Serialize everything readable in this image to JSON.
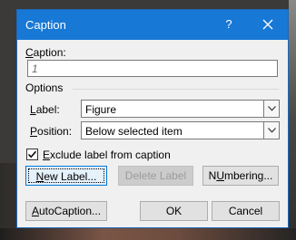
{
  "window": {
    "title": "Caption",
    "help_glyph": "?",
    "close_icon": "close-icon"
  },
  "caption": {
    "label": "Caption:",
    "label_underline": "C",
    "label_rest": "aption:",
    "value": "1"
  },
  "options": {
    "group_label": "Options",
    "label_field": {
      "underline": "L",
      "rest": "abel:",
      "value": "Figure"
    },
    "position_field": {
      "underline": "P",
      "rest": "osition:",
      "value": "Below selected item"
    }
  },
  "exclude": {
    "checked": true,
    "underline": "E",
    "rest": "xclude label from caption"
  },
  "buttons": {
    "new_label": {
      "underline": "N",
      "rest": "ew Label..."
    },
    "delete_label": "Delete Label",
    "numbering": {
      "underline": "U",
      "pre": "N",
      "rest": "mbering..."
    },
    "autocaption": {
      "pre": "",
      "underline": "A",
      "rest": "utoCaption..."
    },
    "ok": "OK",
    "cancel": "Cancel"
  },
  "colors": {
    "titlebar": "#1878d6",
    "dialog_bg": "#f0f0f0",
    "accent_border": "#0078d7"
  }
}
